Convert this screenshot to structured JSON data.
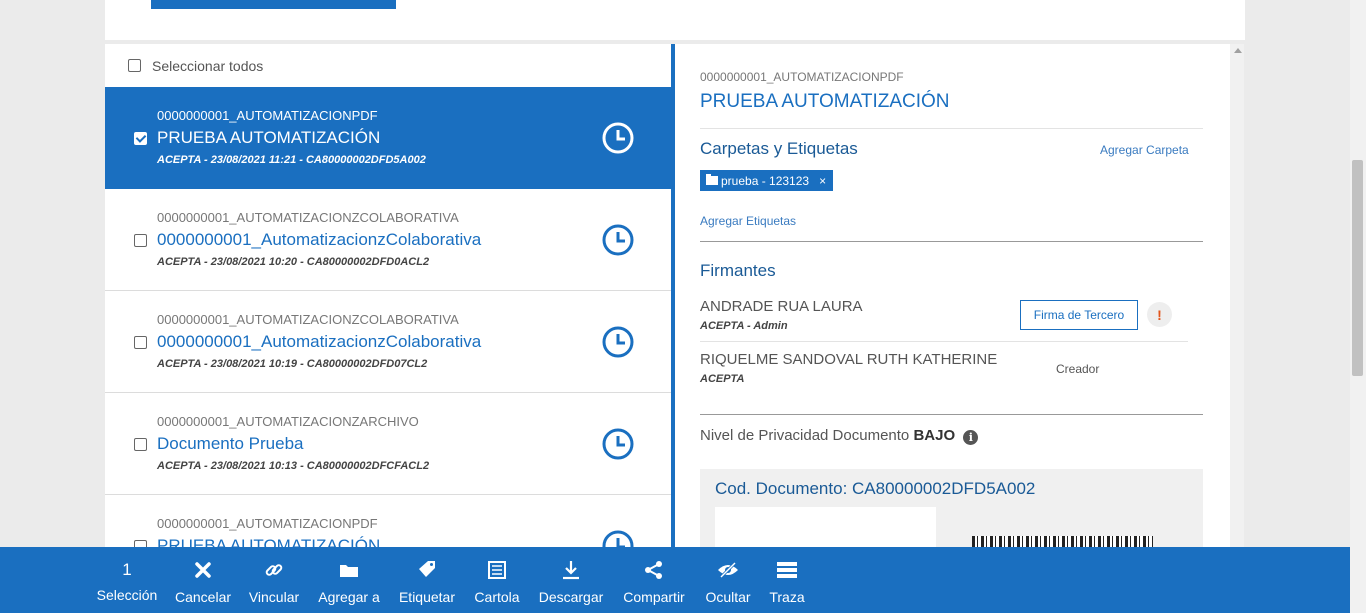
{
  "list": {
    "select_all_label": "Seleccionar todos",
    "documents": [
      {
        "code": "0000000001_AUTOMATIZACIONPDF",
        "title": "PRUEBA AUTOMATIZACIÓN",
        "meta": "ACEPTA - 23/08/2021 11:21 - CA80000002DFD5A002",
        "selected": true
      },
      {
        "code": "0000000001_AUTOMATIZACIONZCOLABORATIVA",
        "title": "0000000001_AutomatizacionzColaborativa",
        "meta": "ACEPTA - 23/08/2021 10:20 - CA80000002DFD0ACL2",
        "selected": false
      },
      {
        "code": "0000000001_AUTOMATIZACIONZCOLABORATIVA",
        "title": "0000000001_AutomatizacionzColaborativa",
        "meta": "ACEPTA - 23/08/2021 10:19 - CA80000002DFD07CL2",
        "selected": false
      },
      {
        "code": "0000000001_AUTOMATIZACIONZARCHIVO",
        "title": "Documento Prueba",
        "meta": "ACEPTA - 23/08/2021 10:13 - CA80000002DFCFACL2",
        "selected": false
      },
      {
        "code": "0000000001_AUTOMATIZACIONPDF",
        "title": "PRUEBA AUTOMATIZACIÓN",
        "meta": "",
        "selected": false
      }
    ]
  },
  "detail": {
    "code": "0000000001_AUTOMATIZACIONPDF",
    "title": "PRUEBA AUTOMATIZACIÓN",
    "folders_title": "Carpetas y Etiquetas",
    "add_folder_label": "Agregar Carpeta",
    "folder_tag": "prueba - 123123",
    "folder_tag_remove": "×",
    "add_tags_label": "Agregar Etiquetas",
    "signers_title": "Firmantes",
    "signers": [
      {
        "name": "ANDRADE RUA LAURA",
        "role": "ACEPTA - Admin",
        "action": "Firma de Tercero",
        "alert": "!"
      },
      {
        "name": "RIQUELME SANDOVAL RUTH KATHERINE",
        "role": "ACEPTA",
        "status": "Creador"
      }
    ],
    "privacy_label": "Nivel de Privacidad Documento",
    "privacy_value": "BAJO",
    "info_glyph": "i",
    "doc_code_label": "Cod. Documento: CA80000002DFD5A002"
  },
  "toolbar": {
    "selection_count": "1",
    "items": [
      {
        "label": "Selección",
        "icon": "count"
      },
      {
        "label": "Cancelar",
        "icon": "close-icon"
      },
      {
        "label": "Vincular",
        "icon": "link-icon"
      },
      {
        "label": "Agregar a",
        "icon": "folder-icon"
      },
      {
        "label": "Etiquetar",
        "icon": "tag-icon"
      },
      {
        "label": "Cartola",
        "icon": "list-doc-icon"
      },
      {
        "label": "Descargar",
        "icon": "download-icon"
      },
      {
        "label": "Compartir",
        "icon": "share-icon"
      },
      {
        "label": "Ocultar",
        "icon": "eye-slash-icon"
      },
      {
        "label": "Traza",
        "icon": "stack-icon"
      }
    ]
  },
  "colors": {
    "accent": "#1a6fc0",
    "alert": "#e2541b"
  }
}
